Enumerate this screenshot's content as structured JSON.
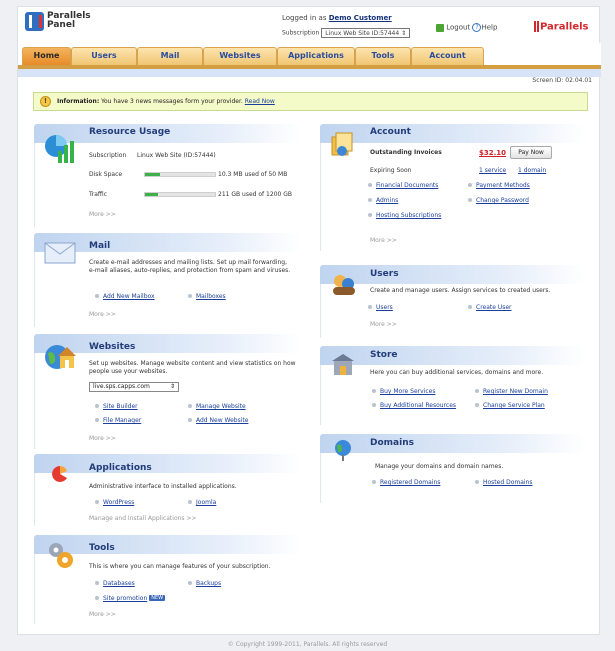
{
  "app": {
    "logo_line1": "Parallels",
    "logo_line2": "Panel",
    "brand": "Parallels",
    "screen_id": "Screen ID: 02.04.01",
    "footer": "© Copyright 1999-2011, Parallels. All rights reserved"
  },
  "user": {
    "logged_prefix": "Logged in as",
    "name": "Demo Customer",
    "subscription_label": "Subscription",
    "subscription_value": "Linux Web Site ID:57444",
    "logout": "Logout",
    "help": "Help"
  },
  "tabs": [
    "Home",
    "Users",
    "Mail",
    "Websites",
    "Applications",
    "Tools",
    "Account"
  ],
  "info": {
    "label": "Information:",
    "text": "You have 3 news messages form your provider.",
    "link": "Read Now"
  },
  "resource": {
    "title": "Resource Usage",
    "sub_label": "Subscription",
    "sub_value": "Linux Web Site (ID:57444)",
    "disk_label": "Disk Space",
    "disk_value": "10.3 MB used of 50 MB",
    "disk_fraction": 0.21,
    "traffic_label": "Traffic",
    "traffic_value": "211 GB used of 1200 GB",
    "traffic_fraction": 0.18,
    "more": "More >>"
  },
  "mail": {
    "title": "Mail",
    "desc": "Create e-mail addresses and mailing lists. Set up mail forwarding, e-mail aliases, auto-replies, and protection from spam and viruses.",
    "link1": "Add New Mailbox",
    "link2": "Mailboxes",
    "more": "More >>"
  },
  "websites": {
    "title": "Websites",
    "desc": "Set up websites. Manage website content and view statistics on how people use your websites.",
    "select": "live.sps.capps.com",
    "link1": "Site Builder",
    "link2": "Manage Website",
    "link3": "File Manager",
    "link4": "Add New Website",
    "more": "More >>"
  },
  "applications": {
    "title": "Applications",
    "desc": "Administrative interface to installed applications.",
    "link1": "WordPress",
    "link2": "Joomla",
    "more": "Manage and Install Applications >>"
  },
  "tools": {
    "title": "Tools",
    "desc": "This is where you can manage features of your subscription.",
    "link1": "Databases",
    "link2": "Backups",
    "link3": "Site promotion",
    "badge": "NEW",
    "more": "More >>"
  },
  "account": {
    "title": "Account",
    "inv_label": "Outstanding Invoices",
    "inv_amount": "$32.10",
    "pay": "Pay Now",
    "exp_label": "Expiring Soon",
    "exp1": "1 service",
    "exp2": "1 domain",
    "link1": "Financial Documents",
    "link2": "Payment Methods",
    "link3": "Admins",
    "link4": "Change Password",
    "link5": "Hosting Subscriptions",
    "more": "More >>"
  },
  "users": {
    "title": "Users",
    "desc": "Create and manage users. Assign services to created users.",
    "link1": "Users",
    "link2": "Create User",
    "more": "More >>"
  },
  "store": {
    "title": "Store",
    "desc": "Here you can buy additional services, domains and more.",
    "link1": "Buy More Services",
    "link2": "Register New Domain",
    "link3": "Buy Additional Resources",
    "link4": "Change Service Plan"
  },
  "domains": {
    "title": "Domains",
    "desc": "Manage your domains and domain names.",
    "link1": "Registered Domains",
    "link2": "Hosted Domains"
  },
  "colors": {
    "accent": "#e78b28",
    "link": "#1a3f9a",
    "brand": "#d3282d",
    "progress": "#3db04a"
  }
}
